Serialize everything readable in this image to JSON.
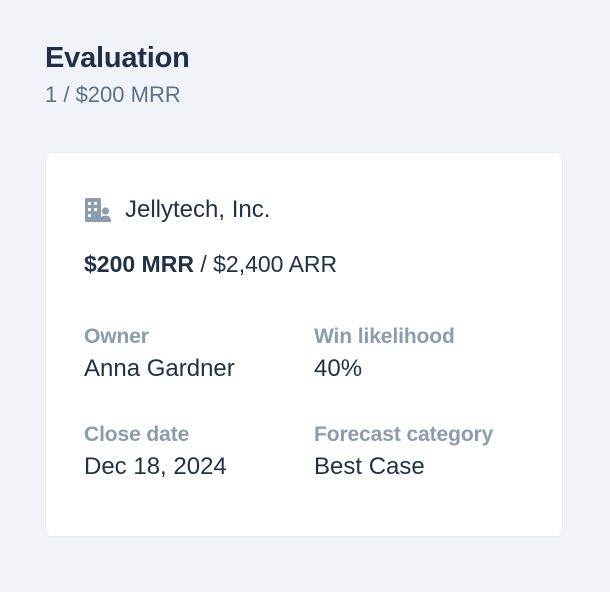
{
  "column": {
    "title": "Evaluation",
    "summary": "1 / $200 MRR"
  },
  "deal": {
    "company_icon": "building-user-icon",
    "company_name": "Jellytech, Inc.",
    "mrr": "$200 MRR",
    "separator": " / ",
    "arr": "$2,400 ARR",
    "fields": {
      "owner": {
        "label": "Owner",
        "value": "Anna Gardner"
      },
      "win_likelihood": {
        "label": "Win likelihood",
        "value": "40%"
      },
      "close_date": {
        "label": "Close date",
        "value": "Dec 18, 2024"
      },
      "forecast_category": {
        "label": "Forecast category",
        "value": "Best Case"
      }
    }
  },
  "colors": {
    "background": "#f0f4f9",
    "card": "#ffffff",
    "text_primary": "#1e3146",
    "text_secondary": "#5c7288",
    "label": "#8a9cae",
    "icon": "#8a9cae"
  }
}
